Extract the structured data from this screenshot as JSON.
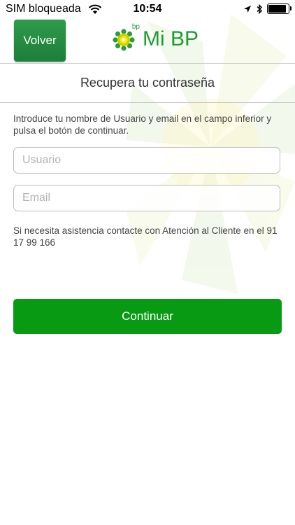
{
  "status_bar": {
    "carrier": "SIM bloqueada",
    "time": "10:54",
    "battery_level": 0.9
  },
  "nav": {
    "back_label": "Volver",
    "logo_small_text": "bp",
    "app_title": "Mi BP"
  },
  "page": {
    "title": "Recupera tu contraseña",
    "instructions": "Introduce tu nombre de Usuario y email en el campo inferior y pulsa el botón de continuar.",
    "username_placeholder": "Usuario",
    "email_placeholder": "Email",
    "help_text": "Si necesita asistencia contacte con Atención al Cliente en el 91 17 99 166",
    "continue_label": "Continuar"
  },
  "colors": {
    "brand_green": "#1c9f2e",
    "button_green": "#099a14",
    "back_button_green": "#2f9a4c"
  }
}
